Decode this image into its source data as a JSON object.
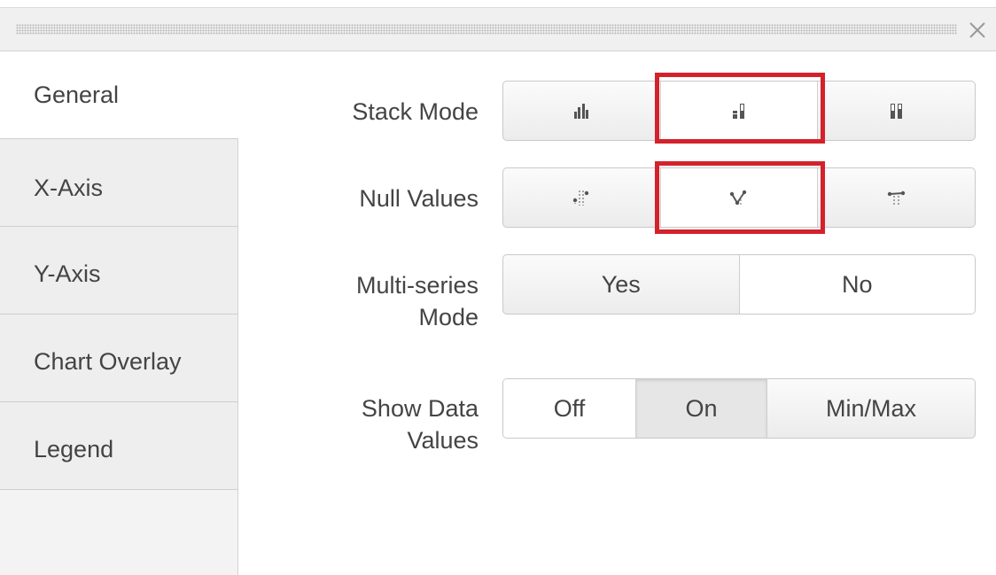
{
  "dialog": {
    "close_icon": "close-x-icon"
  },
  "sidebar": {
    "items": [
      {
        "label": "General",
        "active": true
      },
      {
        "label": "X-Axis",
        "active": false
      },
      {
        "label": "Y-Axis",
        "active": false
      },
      {
        "label": "Chart Overlay",
        "active": false
      },
      {
        "label": "Legend",
        "active": false
      }
    ]
  },
  "general": {
    "stack_mode": {
      "label": "Stack Mode",
      "options": [
        {
          "icon": "not-stacked-icon"
        },
        {
          "icon": "stacked-icon",
          "selected": true
        },
        {
          "icon": "stacked-100-icon"
        }
      ]
    },
    "null_values": {
      "label": "Null Values",
      "options": [
        {
          "icon": "null-gaps-icon"
        },
        {
          "icon": "null-zero-icon",
          "selected": true
        },
        {
          "icon": "null-connect-icon"
        }
      ]
    },
    "multi_series_mode": {
      "label_line1": "Multi-series",
      "label_line2": "Mode",
      "options": [
        {
          "label": "Yes"
        },
        {
          "label": "No",
          "selected": true
        }
      ]
    },
    "show_data_values": {
      "label_line1": "Show Data",
      "label_line2": "Values",
      "options": [
        {
          "label": "Off",
          "selected": true
        },
        {
          "label": "On"
        },
        {
          "label": "Min/Max"
        }
      ]
    }
  },
  "colors": {
    "highlight": "#d3222c",
    "text": "#444444",
    "sidebar_bg": "#eeeeee"
  }
}
